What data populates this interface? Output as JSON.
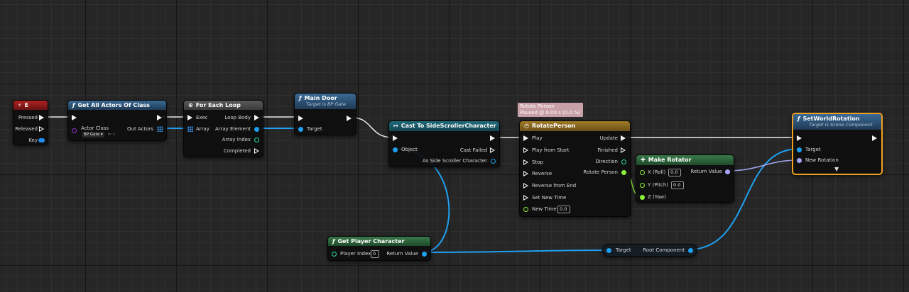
{
  "nodes": {
    "key_e": {
      "title": "E",
      "pins": {
        "pressed": "Pressed",
        "released": "Released",
        "key": "Key"
      }
    },
    "get_all_actors": {
      "title": "Get All Actors Of Class",
      "pins": {
        "actor_class": "Actor Class",
        "actor_class_value": "BP Gate",
        "out_actors": "Out Actors"
      }
    },
    "for_each": {
      "title": "For Each Loop",
      "pins": {
        "exec": "Exec",
        "array": "Array",
        "loop_body": "Loop Body",
        "array_element": "Array Element",
        "array_index": "Array Index",
        "completed": "Completed"
      }
    },
    "main_door": {
      "title": "Main Door",
      "subtitle": "Target is BP Gate",
      "pins": {
        "target": "Target"
      }
    },
    "cast": {
      "title": "Cast To SideScrollerCharacter",
      "pins": {
        "object": "Object",
        "cast_failed": "Cast Failed",
        "as_character": "As Side Scroller Character"
      }
    },
    "timeline_comment": {
      "line1": "Rotate Person",
      "line2": "Paused @ 0.00 s (0.0 %)"
    },
    "rotate_person": {
      "title": "RotatePerson",
      "pins": {
        "play": "Play",
        "play_from_start": "Play from Start",
        "stop": "Stop",
        "reverse": "Reverse",
        "reverse_from_end": "Reverse from End",
        "set_new_time": "Set New Time",
        "new_time": "New Time",
        "new_time_value": "0.0",
        "update": "Update",
        "finished": "Finished",
        "direction": "Direction",
        "rotate_person": "Rotate Person"
      }
    },
    "make_rotator": {
      "title": "Make Rotator",
      "pins": {
        "x": "X (Roll)",
        "x_value": "0.0",
        "y": "Y (Pitch)",
        "y_value": "0.0",
        "z": "Z (Yaw)",
        "return_value": "Return Value"
      }
    },
    "set_world_rotation": {
      "title": "SetWorldRotation",
      "subtitle": "Target is Scene Component",
      "pins": {
        "target": "Target",
        "new_rotation": "New Rotation"
      }
    },
    "get_player_character": {
      "title": "Get Player Character",
      "pins": {
        "player_index": "Player Index",
        "player_index_value": "0",
        "return_value": "Return Value"
      }
    },
    "root_component": {
      "pins": {
        "target": "Target",
        "root_component": "Root Component"
      }
    }
  },
  "colors": {
    "exec": "#f2f2f2",
    "object_pin": "#1fa0f0",
    "float_pin": "#8ef03a",
    "struct_pin": "#a6a6f5",
    "event_header": "#9a1c1c",
    "function_header": "#2b4a6a",
    "pure_header": "#2f6a3a",
    "timeline_header": "#8a6a20",
    "macro_header": "#555555",
    "selection": "#f0a020"
  }
}
